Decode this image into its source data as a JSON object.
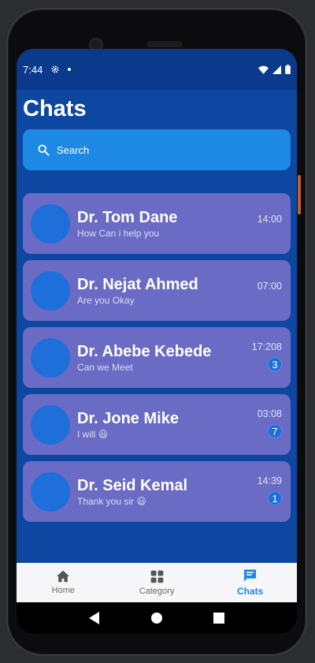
{
  "status_bar": {
    "time": "7:44"
  },
  "page_title": "Chats",
  "search": {
    "placeholder": "Search"
  },
  "chats": [
    {
      "name": "Dr. Tom Dane",
      "message": "How Can i help you",
      "time": "14:00",
      "unread": null
    },
    {
      "name": "Dr. Nejat Ahmed",
      "message": "Are you Okay",
      "time": "07:00",
      "unread": null
    },
    {
      "name": "Dr. Abebe Kebede",
      "message": "Can we Meet",
      "time": "17:208",
      "unread": "3"
    },
    {
      "name": "Dr. Jone Mike",
      "message": "I will 😃",
      "time": "03:08",
      "unread": "7"
    },
    {
      "name": "Dr. Seid Kemal",
      "message": "Thank you sir 😃",
      "time": "14:39",
      "unread": "1"
    }
  ],
  "bottom_nav": [
    {
      "label": "Home",
      "icon": "home-icon",
      "active": false
    },
    {
      "label": "Category",
      "icon": "grid-icon",
      "active": false
    },
    {
      "label": "Chats",
      "icon": "chat-icon",
      "active": true
    }
  ],
  "colors": {
    "screen_bg": "#0d47a1",
    "search_bg": "#1e88e5",
    "card_bg": "#6a6bc4",
    "avatar": "#1e6fd9",
    "active_nav": "#1e88e5"
  }
}
